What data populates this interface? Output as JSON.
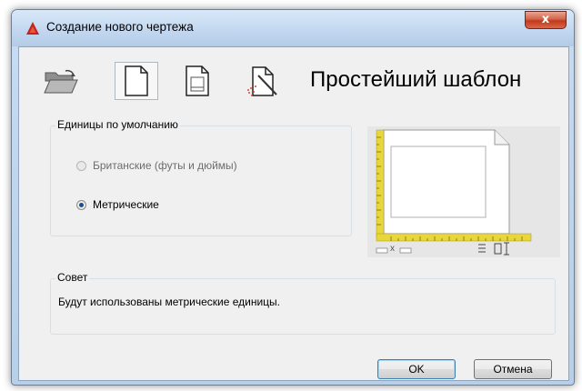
{
  "window": {
    "title": "Создание нового чертежа",
    "close_label": "x"
  },
  "toolbar": {
    "buttons": [
      {
        "icon": "open-folder-icon",
        "active": false
      },
      {
        "icon": "blank-document-icon",
        "active": true
      },
      {
        "icon": "template-document-icon",
        "active": false
      },
      {
        "icon": "wizard-icon",
        "active": false
      }
    ]
  },
  "heading": "Простейший шаблон",
  "units": {
    "group_label": "Единицы по умолчанию",
    "options": [
      {
        "label": "Британские (футы и дюймы)",
        "selected": false
      },
      {
        "label": "Метрические",
        "selected": true
      }
    ]
  },
  "preview": {
    "icon": "drawing-sheet-preview-icon",
    "size_label": "x"
  },
  "hint": {
    "group_label": "Совет",
    "text": "Будут использованы метрические единицы."
  },
  "buttons": {
    "ok": "OK",
    "cancel": "Отмена"
  },
  "colors": {
    "accent": "#1b4f8c",
    "close_red": "#c1391c",
    "ruler_yellow": "#e8d63a"
  }
}
